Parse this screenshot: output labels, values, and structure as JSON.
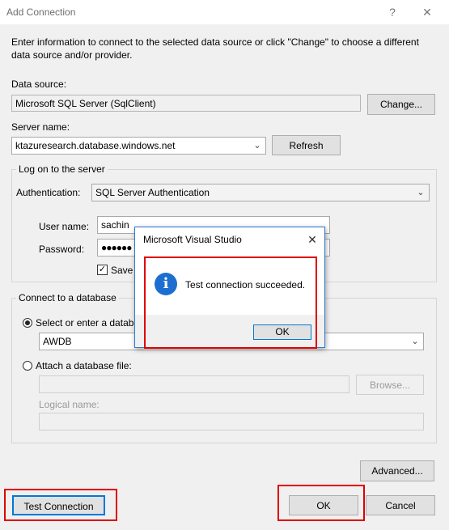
{
  "window": {
    "title": "Add Connection",
    "help_glyph": "?",
    "close_glyph": "✕"
  },
  "instructions": "Enter information to connect to the selected data source or click \"Change\" to choose a different data source and/or provider.",
  "data_source": {
    "label": "Data source:",
    "value": "Microsoft SQL Server (SqlClient)",
    "change_button": "Change..."
  },
  "server": {
    "label": "Server name:",
    "value": "ktazuresearch.database.windows.net",
    "refresh_button": "Refresh"
  },
  "logon": {
    "group_title": "Log on to the server",
    "auth_label": "Authentication:",
    "auth_value": "SQL Server Authentication",
    "user_label": "User name:",
    "user_value": "sachin",
    "password_label": "Password:",
    "password_value": "●●●●●●",
    "save_label": "Save r",
    "save_checked": true
  },
  "database": {
    "group_title": "Connect to a database",
    "select_label": "Select or enter a databa",
    "select_value": "AWDB",
    "attach_label": "Attach a database file:",
    "browse_button": "Browse...",
    "logical_label": "Logical name:"
  },
  "buttons": {
    "advanced": "Advanced...",
    "test_connection": "Test Connection",
    "ok": "OK",
    "cancel": "Cancel"
  },
  "message_box": {
    "title": "Microsoft Visual Studio",
    "close_glyph": "✕",
    "icon": "info-icon",
    "icon_glyph": "i",
    "message": "Test connection succeeded.",
    "ok_button": "OK"
  },
  "colors": {
    "highlight_red": "#e00000",
    "info_blue": "#1c6fd1",
    "focus_blue": "#0078d7"
  }
}
